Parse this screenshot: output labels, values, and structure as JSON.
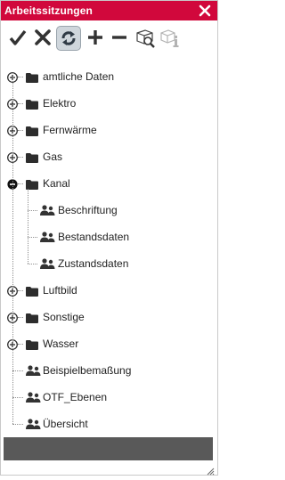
{
  "window": {
    "title": "Arbeitssitzungen",
    "accent_color": "#d1083c",
    "close_icon": "close-icon"
  },
  "toolbar": {
    "buttons": [
      {
        "name": "check-icon",
        "active": false
      },
      {
        "name": "cross-icon",
        "active": false
      },
      {
        "name": "refresh-icon",
        "active": true
      },
      {
        "name": "plus-icon",
        "active": false
      },
      {
        "name": "minus-icon",
        "active": false
      },
      {
        "name": "zoom-to-extent-icon",
        "active": false
      },
      {
        "name": "layer-info-icon",
        "active": false,
        "disabled": true
      }
    ]
  },
  "tree": {
    "nodes": [
      {
        "label": "amtliche Daten",
        "type": "folder",
        "state": "collapsed"
      },
      {
        "label": "Elektro",
        "type": "folder",
        "state": "collapsed"
      },
      {
        "label": "Fernwärme",
        "type": "folder",
        "state": "collapsed"
      },
      {
        "label": "Gas",
        "type": "folder",
        "state": "collapsed"
      },
      {
        "label": "Kanal",
        "type": "folder",
        "state": "expanded",
        "children": [
          {
            "label": "Beschriftung",
            "type": "session"
          },
          {
            "label": "Bestandsdaten",
            "type": "session"
          },
          {
            "label": "Zustandsdaten",
            "type": "session"
          }
        ]
      },
      {
        "label": "Luftbild",
        "type": "folder",
        "state": "collapsed"
      },
      {
        "label": "Sonstige",
        "type": "folder",
        "state": "collapsed"
      },
      {
        "label": "Wasser",
        "type": "folder",
        "state": "collapsed"
      },
      {
        "label": "Beispielbemaßung",
        "type": "session"
      },
      {
        "label": "OTF_Ebenen",
        "type": "session"
      },
      {
        "label": "Übersicht",
        "type": "session"
      }
    ]
  }
}
